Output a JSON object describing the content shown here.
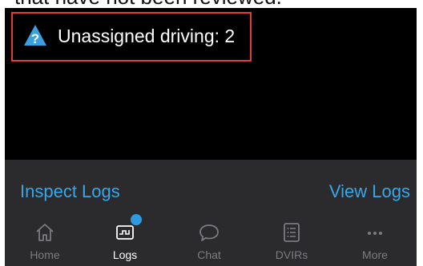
{
  "caption": "that have not been reviewed.",
  "alert": {
    "icon": "question-warning-icon",
    "text": "Unassigned driving: 2",
    "highlight_color": "#e23b3b"
  },
  "actions": {
    "left_label": "Inspect Logs",
    "right_label": "View Logs",
    "color": "#38a7e8"
  },
  "tabbar": {
    "items": [
      {
        "label": "Home",
        "icon": "home-icon",
        "active": false
      },
      {
        "label": "Logs",
        "icon": "logs-icon",
        "active": true,
        "badge": true
      },
      {
        "label": "Chat",
        "icon": "chat-icon",
        "active": false
      },
      {
        "label": "DVIRs",
        "icon": "dvir-list-icon",
        "active": false
      },
      {
        "label": "More",
        "icon": "more-icon",
        "active": false
      }
    ],
    "badge_color": "#2f9ae0"
  }
}
